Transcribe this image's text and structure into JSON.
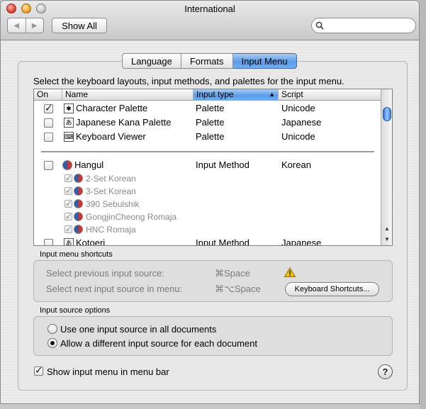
{
  "window": {
    "title": "International"
  },
  "toolbar": {
    "back_label": "◀",
    "forward_label": "▶",
    "show_all_label": "Show All",
    "search_placeholder": ""
  },
  "tabs": [
    {
      "label": "Language",
      "active": false
    },
    {
      "label": "Formats",
      "active": false
    },
    {
      "label": "Input Menu",
      "active": true
    }
  ],
  "description": "Select the keyboard layouts, input methods, and palettes for the input menu.",
  "table": {
    "headers": {
      "on": "On",
      "name": "Name",
      "input_type": "Input type",
      "script": "Script"
    },
    "sort_indicator": "▲",
    "rows": [
      {
        "name": "Character Palette",
        "type": "Palette",
        "script": "Unicode",
        "checked": true,
        "icon_glyph": "✱"
      },
      {
        "name": "Japanese Kana Palette",
        "type": "Palette",
        "script": "Japanese",
        "checked": false,
        "icon_glyph": "あ"
      },
      {
        "name": "Keyboard Viewer",
        "type": "Palette",
        "script": "Unicode",
        "checked": false,
        "icon_glyph": "⌨"
      },
      {
        "name": "Hangul",
        "type": "Input Method",
        "script": "Korean",
        "checked": false
      },
      {
        "name": "2-Set Korean",
        "sub_index": "2"
      },
      {
        "name": "3-Set Korean",
        "sub_index": "3"
      },
      {
        "name": "390 Sebulshik",
        "sub_index": "3"
      },
      {
        "name": "GongjinCheong Romaja",
        "sub_index": "G"
      },
      {
        "name": "HNC Romaja",
        "sub_index": "H"
      },
      {
        "name": "Kotoeri",
        "type": "Input Method",
        "script": "Japanese",
        "checked": false,
        "icon_glyph": "あ"
      }
    ],
    "scroll_up": "▲",
    "scroll_down": "▼"
  },
  "shortcuts": {
    "label": "Input menu shortcuts",
    "previous_label": "Select previous input source:",
    "previous_key": "⌘Space",
    "next_label": "Select next input source in menu:",
    "next_key": "⌘⌥Space",
    "keyboard_shortcuts_button": "Keyboard Shortcuts..."
  },
  "source_options": {
    "label": "Input source options",
    "option_all": "Use one input source in all documents",
    "option_each": "Allow a different input source for each document",
    "selected": "each"
  },
  "show_menu_label": "Show input menu in menu bar",
  "show_menu_checked": true,
  "help_label": "?",
  "colors": {
    "accent": "#5a9be8",
    "warning": "#f2c20c"
  }
}
